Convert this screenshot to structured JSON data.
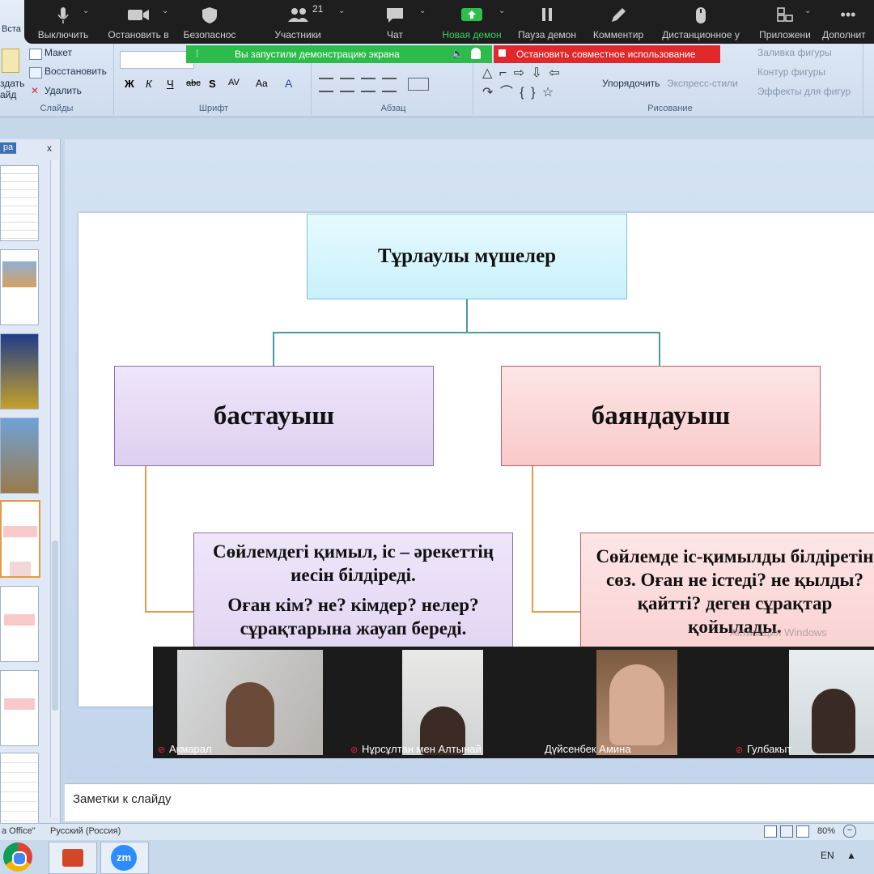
{
  "zoom_toolbar": {
    "items": [
      {
        "label": "Выключить"
      },
      {
        "label": "Остановить в"
      },
      {
        "label": "Безопаснос"
      },
      {
        "label": "Участники",
        "count": "21"
      },
      {
        "label": "Чат"
      },
      {
        "label": "Новая демон"
      },
      {
        "label": "Пауза демон"
      },
      {
        "label": "Комментир"
      },
      {
        "label": "Дистанционное у"
      },
      {
        "label": "Приложени"
      },
      {
        "label": "Дополнит"
      }
    ],
    "share_notice": "Вы запустили демонстрацию экрана",
    "stop_share": "Остановить совместное использование"
  },
  "ribbon": {
    "partial_tab": "Вста",
    "slides_group": {
      "create": "здать",
      "create2": "айд",
      "layout": "Макет",
      "reset": "Восстановить",
      "delete": "Удалить",
      "label": "Слайды"
    },
    "font_group": {
      "label": "Шрифт",
      "buttons": [
        "Ж",
        "К",
        "Ч",
        "abc",
        "S",
        "AV",
        "Aa",
        "A"
      ]
    },
    "paragraph_group": {
      "label": "Абзац"
    },
    "drawing_group": {
      "label": "Рисование",
      "arrange": "Упорядочить",
      "quick_styles": "Экспресс-стили",
      "fill": "Заливка фигуры",
      "outline": "Контур фигуры",
      "effects": "Эффекты для фигур"
    }
  },
  "thumb_pane": {
    "tab": "ра",
    "close": "x"
  },
  "slide": {
    "title": "Тұрлаулы мүшелер",
    "left_head": "бастауыш",
    "right_head": "баяндауыш",
    "left_body_1": "Сөйлемдегі қимыл, іс – әрекеттің иесін білдіреді.",
    "left_body_2": "Оған кім? не? кімдер? нелер? сұрақтарына жауап береді.",
    "right_body_1": "Сөйлемде іс-қимылды білдіретін сөз. Оған не істеді? не қылды? қайтті? деген сұрақтар қойылады.",
    "watermark": "Активация Windows",
    "colors": {
      "title_fill": "#c9f1fb",
      "left_fill": "#ddcff0",
      "right_fill": "#f9c9c9",
      "connector_blue": "#4a9aa6",
      "connector_orange": "#e39a4a"
    }
  },
  "notes": {
    "placeholder": "Заметки к слайду"
  },
  "status_bar": {
    "theme": "а Office\"",
    "language": "Русский (Россия)",
    "zoom": "80%"
  },
  "video_tiles": [
    {
      "name": "Акмарал"
    },
    {
      "name": "Нұрсұлтан мен Алтынай"
    },
    {
      "name": "Дүйсенбек Амина"
    },
    {
      "name": "Гулбакыт"
    }
  ],
  "taskbar": {
    "lang": "EN",
    "zoom_app": "zm"
  }
}
